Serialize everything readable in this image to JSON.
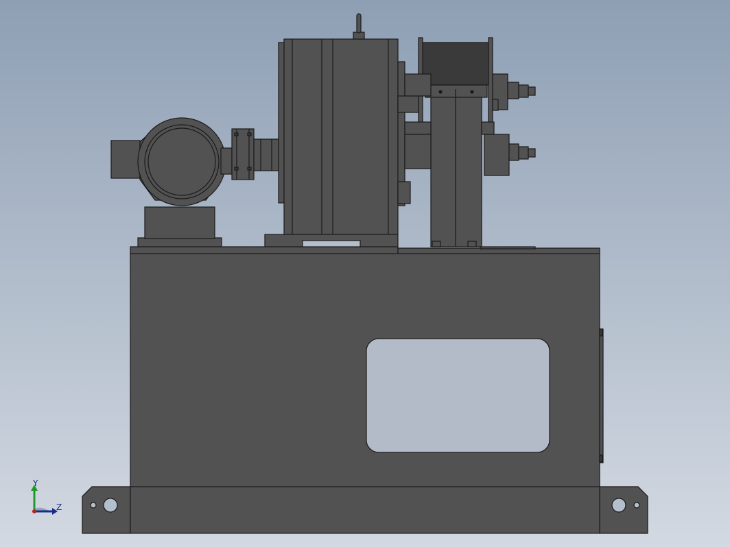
{
  "viewport": {
    "background_top": "#8e9fb4",
    "background_bottom": "#d3d9e2",
    "part_fill": "#525252",
    "part_dark": "#3a3a3a",
    "edge_color": "#1a1a1a"
  },
  "triad": {
    "y_label": "Y",
    "z_label": "Z",
    "y_color": "#1f9a2a",
    "z_color": "#1a2b8c",
    "origin_color": "#c0201a"
  },
  "model": {
    "components": [
      "base-tank",
      "inspection-window",
      "mounting-foot-left",
      "mounting-foot-right",
      "electric-motor",
      "motor-pedestal",
      "coupling-flange",
      "pump-housing",
      "lifting-eye",
      "valve-block",
      "outlet-fitting-upper",
      "outlet-fitting-lower"
    ]
  }
}
